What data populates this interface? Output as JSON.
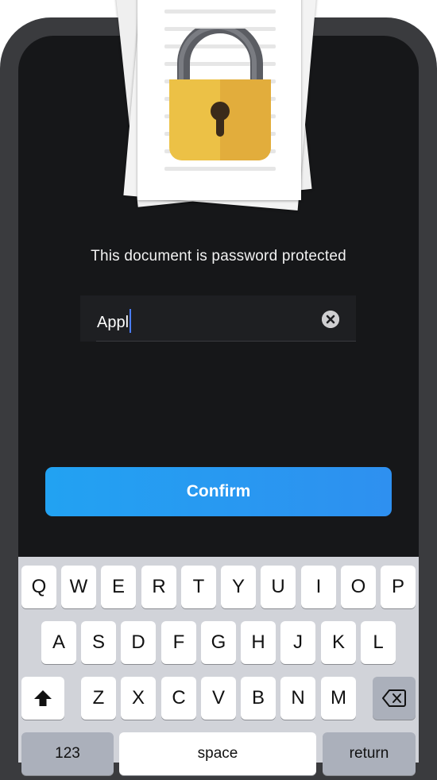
{
  "prompt": "This document is password protected",
  "password_field": {
    "value": "Appl"
  },
  "confirm_label": "Confirm",
  "keyboard": {
    "row1": [
      "Q",
      "W",
      "E",
      "R",
      "T",
      "Y",
      "U",
      "I",
      "O",
      "P"
    ],
    "row2": [
      "A",
      "S",
      "D",
      "F",
      "G",
      "H",
      "J",
      "K",
      "L"
    ],
    "row3": [
      "Z",
      "X",
      "C",
      "V",
      "B",
      "N",
      "M"
    ],
    "numbers_label": "123",
    "space_label": "space",
    "return_label": "return"
  },
  "icons": {
    "lock": "padlock-icon",
    "clear": "clear-x-icon",
    "shift": "shift-arrow-icon",
    "backspace": "backspace-icon"
  },
  "colors": {
    "background": "#161719",
    "accent": "#2e90f0",
    "lock_body": "#ecc146"
  }
}
